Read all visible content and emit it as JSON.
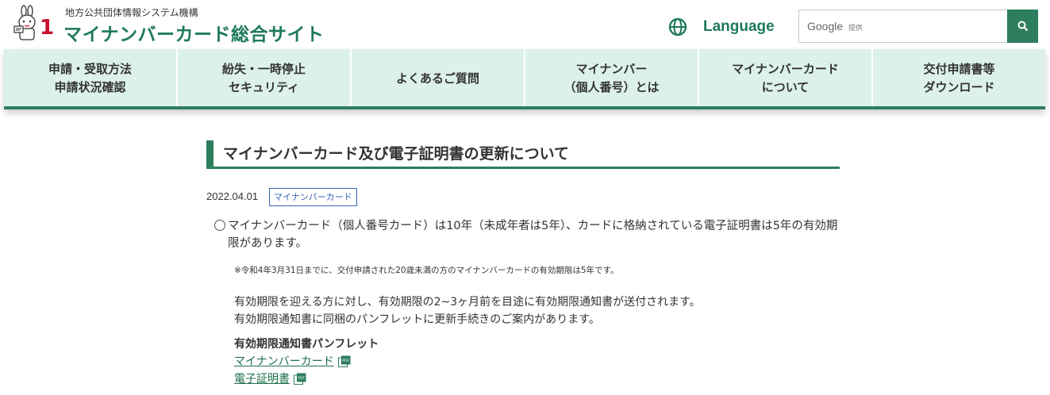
{
  "header": {
    "org_name": "地方公共団体情報システム機構",
    "site_title": "マイナンバーカード総合サイト",
    "logo_number": "1",
    "language_label": "Language",
    "search": {
      "brand": "Google",
      "provided_label": "提供",
      "button_icon": "search-icon"
    }
  },
  "nav": {
    "items": [
      {
        "label": "申請・受取方法\n申請状況確認"
      },
      {
        "label": "紛失・一時停止\nセキュリティ"
      },
      {
        "label": "よくあるご質問"
      },
      {
        "label": "マイナンバー\n（個人番号）とは"
      },
      {
        "label": "マイナンバーカード\nについて"
      },
      {
        "label": "交付申請書等\nダウンロード"
      }
    ]
  },
  "article": {
    "title": "マイナンバーカード及び電子証明書の更新について",
    "date": "2022.04.01",
    "tag": "マイナンバーカード",
    "para1": "マイナンバーカード（個人番号カード）は10年（未成年者は5年）、カードに格納されている電子証明書は5年の有効期限があります。",
    "note": "※令和4年3月31日までに、交付申請された20歳未満の方のマイナンバーカードの有効期限は5年です。",
    "para2_line1": "有効期限を迎える方に対し、有効期限の2~3ヶ月前を目途に有効期限通知書が送付されます。",
    "para2_line2": "有効期限通知書に同梱のパンフレットに更新手続きのご案内があります。",
    "pamphlet_heading": "有効期限通知書パンフレット",
    "links": [
      {
        "label": "マイナンバーカード",
        "icon": "pdf-icon"
      },
      {
        "label": "電子証明書",
        "icon": "pdf-icon"
      }
    ]
  },
  "colors": {
    "brand_green": "#2e7d5e",
    "nav_bg": "#ddf1ec",
    "tag_blue": "#3a66b4",
    "logo_red": "#c8102e"
  }
}
